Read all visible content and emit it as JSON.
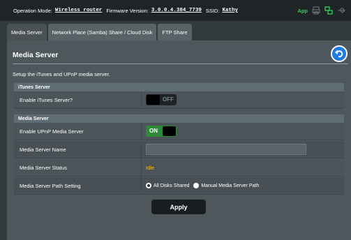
{
  "topbar": {
    "mode_label": "Operation Mode:",
    "mode_value": "Wireless router",
    "firmware_label": "Firmware Version:",
    "firmware_value": "3.0.0.4.384_7739",
    "ssid_label": "SSID:",
    "ssid_value": "Kathy",
    "app_label": "App",
    "icons": [
      "printer-icon",
      "network-icon",
      "usb-icon"
    ]
  },
  "tabs": [
    {
      "label": "Media Server",
      "active": true
    },
    {
      "label": "Network Place (Samba) Share / Cloud Disk",
      "active": false
    },
    {
      "label": "FTP Share",
      "active": false
    }
  ],
  "panel": {
    "title": "Media Server",
    "description": "Setup the iTunes and UPnP media server.",
    "back_icon": "back-arrow-icon"
  },
  "itunes_section": {
    "header": "iTunes Server",
    "enable_label": "Enable iTunes Server?",
    "toggle_text": "OFF",
    "toggle_state": false
  },
  "media_section": {
    "header": "Media Server",
    "enable_label": "Enable UPnP Media Server",
    "toggle_text": "ON",
    "toggle_state": true,
    "name_label": "Media Server Name",
    "name_value": "",
    "status_label": "Media Server Status",
    "status_value": "Idle",
    "path_label": "Media Server Path Setting",
    "path_option_all": "All Disks Shared",
    "path_option_manual": "Manual Media Server Path",
    "path_selected": "All Disks Shared"
  },
  "apply_label": "Apply",
  "colors": {
    "accent_green": "#36d15e",
    "status_yellow": "#ffc00a",
    "back_button_blue": "#1f7be0"
  }
}
